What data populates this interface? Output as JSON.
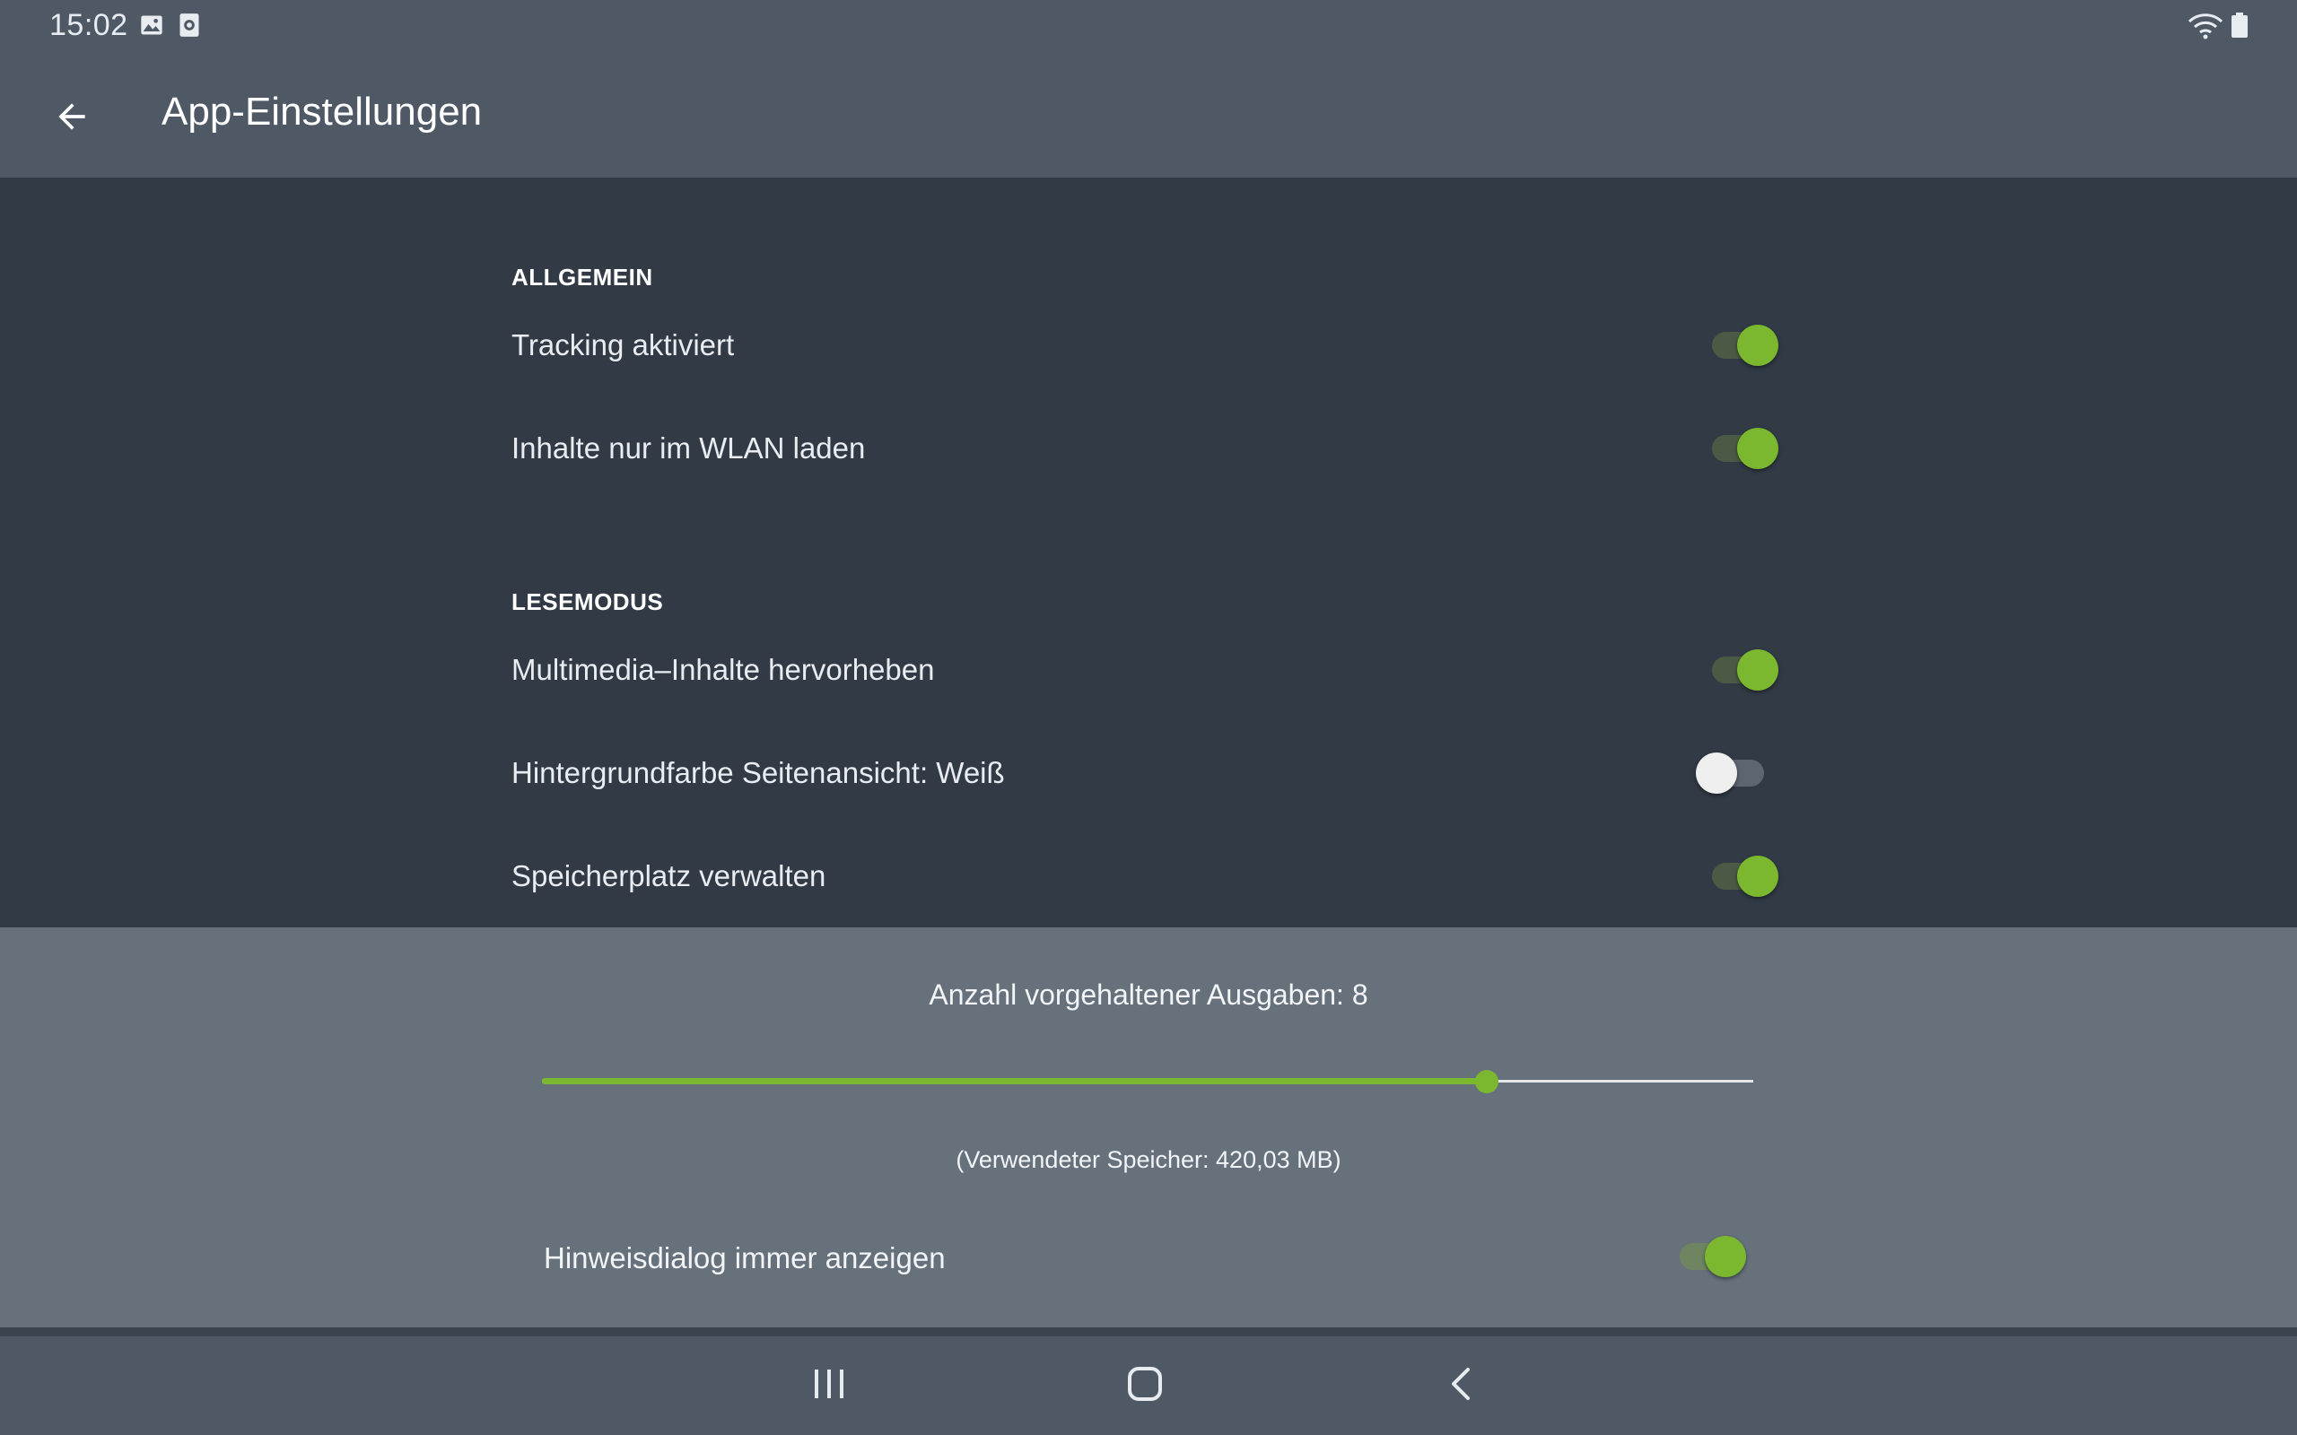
{
  "status_bar": {
    "time": "15:02",
    "icons": [
      "image-icon",
      "screen-recorder-icon",
      "wifi-icon",
      "battery-icon"
    ]
  },
  "app_bar": {
    "back_icon": "arrow-left-icon",
    "title": "App-Einstellungen"
  },
  "sections": {
    "general": {
      "header": "ALLGEMEIN",
      "items": [
        {
          "label": "Tracking aktiviert",
          "on": true
        },
        {
          "label": "Inhalte nur im WLAN laden",
          "on": true
        }
      ]
    },
    "reading": {
      "header": "LESEMODUS",
      "items": [
        {
          "label": "Multimedia–Inhalte hervorheben",
          "on": true
        },
        {
          "label": "Hintergrundfarbe Seitenansicht: Weiß",
          "on": false
        },
        {
          "label": "Speicherplatz verwalten",
          "on": true
        }
      ]
    }
  },
  "storage_panel": {
    "slider_label": "Anzahl vorgehaltener Ausgaben: 8",
    "slider_fraction": 0.78,
    "used_storage": "(Verwendeter Speicher: 420,03 MB)",
    "hint_dialog": {
      "label": "Hinweisdialog immer anzeigen",
      "on": true
    }
  },
  "colors": {
    "accent": "#7cb82f",
    "appbar": "#4f5966",
    "content_bg": "#313a45",
    "panel_bg": "#66717c"
  },
  "nav_bar": {
    "icons": [
      "recent-apps-icon",
      "home-icon",
      "back-icon"
    ]
  }
}
